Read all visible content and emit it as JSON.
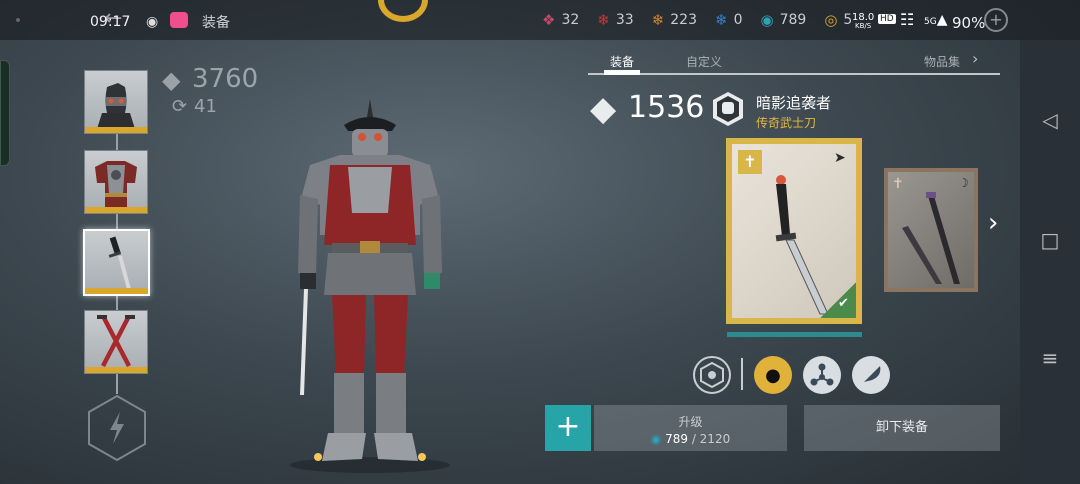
{
  "status_bar": {
    "time": "09:17",
    "title": "装备",
    "resources": [
      {
        "icon": "crimson-diamond-icon",
        "value": "32",
        "color": "#c14a6a"
      },
      {
        "icon": "red-flame-icon",
        "value": "33",
        "color": "#c8343a"
      },
      {
        "icon": "orange-flame-icon",
        "value": "223",
        "color": "#d7822e"
      },
      {
        "icon": "blue-drop-icon",
        "value": "0",
        "color": "#3b7fc4"
      },
      {
        "icon": "teal-coin-icon",
        "value": "789",
        "color": "#2aa3b6"
      },
      {
        "icon": "gold-coin-icon",
        "value": "5",
        "color": "#d9a72c"
      }
    ],
    "net_speed": "18.0",
    "net_unit": "KB/S",
    "battery": "90%",
    "hd_label": "HD",
    "signal_label": "5G"
  },
  "left": {
    "power": "3760",
    "upgrades": "41"
  },
  "tabs": [
    {
      "label": "装备"
    },
    {
      "label": "自定义"
    },
    {
      "label": "物品集"
    }
  ],
  "item": {
    "power": "1536",
    "name": "暗影追袭者",
    "subtitle": "传奇武士刀"
  },
  "actions": {
    "plus": "+",
    "upgrade_label": "升级",
    "upgrade_current": "789",
    "upgrade_sep": " / ",
    "upgrade_total": "2120",
    "unequip_label": "卸下装备"
  },
  "colors": {
    "accent_teal": "#27a4a8",
    "legendary_gold": "#d9b64a",
    "equipped_green": "#4a8a4a"
  }
}
